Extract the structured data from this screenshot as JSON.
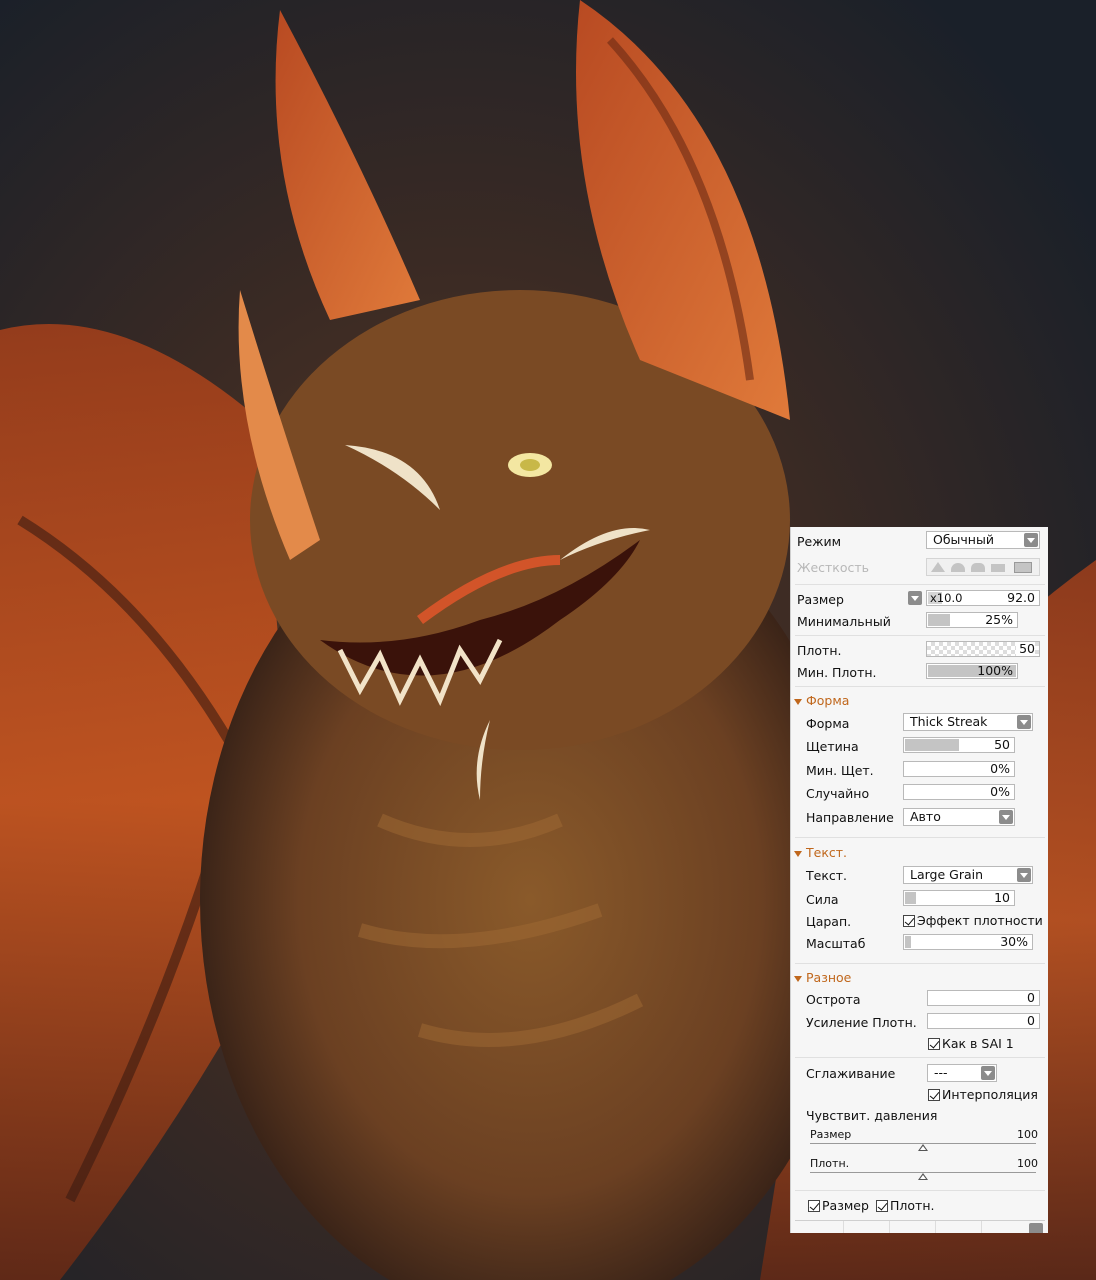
{
  "panel": {
    "mode": {
      "label": "Режим",
      "value": "Обычный"
    },
    "hardness": {
      "label": "Жесткость"
    },
    "size": {
      "label": "Размер",
      "multiplier": "x10.0",
      "value": "92.0"
    },
    "min_size": {
      "label": "Минимальный",
      "value": "25%",
      "fill": 0.25
    },
    "density": {
      "label": "Плотн.",
      "value": "50"
    },
    "min_density": {
      "label": "Мин. Плотн.",
      "value": "100%",
      "fill": 1.0
    },
    "shape_section": {
      "title": "Форма",
      "shape": {
        "label": "Форма",
        "value": "Thick Streak"
      },
      "bristle": {
        "label": "Щетина",
        "value": "50",
        "fill": 0.5
      },
      "min_bristle": {
        "label": "Мин. Щет.",
        "value": "0%",
        "fill": 0.0
      },
      "random": {
        "label": "Случайно",
        "value": "0%",
        "fill": 0.0
      },
      "direction": {
        "label": "Направление",
        "value": "Авто"
      }
    },
    "texture_section": {
      "title": "Текст.",
      "texture": {
        "label": "Текст.",
        "value": "Large Grain"
      },
      "strength": {
        "label": "Сила",
        "value": "10",
        "fill": 0.1
      },
      "scratch": {
        "label": "Царап.",
        "checkbox": "Эффект плотности"
      },
      "scale": {
        "label": "Масштаб",
        "value": "30%",
        "fill": 0.06
      }
    },
    "misc_section": {
      "title": "Разное",
      "sharpness": {
        "label": "Острота",
        "value": "0"
      },
      "density_boost": {
        "label": "Усиление Плотн.",
        "value": "0"
      },
      "like_sai1": {
        "label": "Как в SAI 1"
      },
      "smoothing": {
        "label": "Сглаживание",
        "value": "---"
      },
      "interpolation": {
        "label": "Интерполяция"
      },
      "pressure_title": "Чувствит. давления",
      "pressure_size": {
        "label": "Размер",
        "value": "100",
        "level": 0.5
      },
      "pressure_density": {
        "label": "Плотн.",
        "value": "100",
        "level": 0.5
      },
      "bottom_size": {
        "label": "Размер"
      },
      "bottom_density": {
        "label": "Плотн."
      }
    }
  },
  "colors": {
    "accent": "#c0671c",
    "panel_bg": "#f6f6f6"
  }
}
